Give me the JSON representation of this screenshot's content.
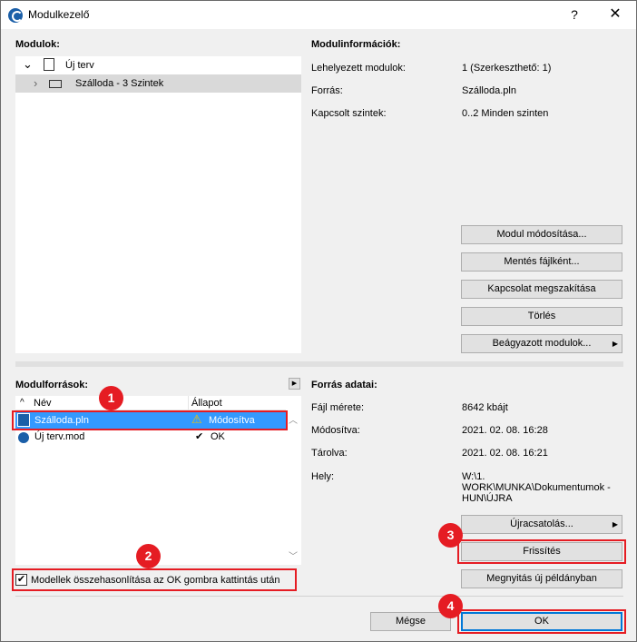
{
  "window": {
    "title": "Modulkezelő",
    "help": "?",
    "close": "✕"
  },
  "modules": {
    "heading": "Modulok:",
    "tree": [
      {
        "label": "Új terv",
        "expander": "⌄"
      },
      {
        "label": "Szálloda - 3 Szintek",
        "expander": "›"
      }
    ]
  },
  "module_info": {
    "heading": "Modulinformációk:",
    "rows": [
      {
        "key": "Lehelyezett modulok:",
        "value": "1 (Szerkeszthető: 1)"
      },
      {
        "key": "Forrás:",
        "value": "Szálloda.pln"
      },
      {
        "key": "Kapcsolt szintek:",
        "value": "0..2 Minden szinten"
      }
    ],
    "buttons": {
      "edit": "Modul módosítása...",
      "save_as_file": "Mentés fájlként...",
      "break_link": "Kapcsolat megszakítása",
      "delete": "Törlés",
      "embedded": "Beágyazott modulok...",
      "embedded_arrow": "▶"
    }
  },
  "module_sources": {
    "heading": "Modulforrások:",
    "expand_arrow": "▶",
    "columns": {
      "name": "Név",
      "status": "Állapot"
    },
    "rows": [
      {
        "name": "Szálloda.pln",
        "status": "Módosítva",
        "status_icon": "⚠"
      },
      {
        "name": "Új terv.mod",
        "status": "OK",
        "status_icon": "✔"
      }
    ],
    "scroll_up": "︿",
    "scroll_down": "﹀"
  },
  "source_data": {
    "heading": "Forrás adatai:",
    "rows": [
      {
        "key": "Fájl mérete:",
        "value": "8642 kbájt"
      },
      {
        "key": "Módosítva:",
        "value": "2021. 02. 08. 16:28"
      },
      {
        "key": "Tárolva:",
        "value": "2021. 02. 08. 16:21"
      },
      {
        "key": "Hely:",
        "value": "W:\\1.\nWORK\\MUNKA\\Dokumentumok -\nHUN\\ÚJRA"
      }
    ],
    "buttons": {
      "relink": "Újracsatolás...",
      "relink_arrow": "▶",
      "refresh": "Frissítés",
      "open_new_instance": "Megnyitás új példányban"
    }
  },
  "compare_checkbox": {
    "label": "Modellek összehasonlítása az OK gombra kattintás után",
    "checked": "✔"
  },
  "footer": {
    "cancel": "Mégse",
    "ok": "OK"
  },
  "badges": [
    "1",
    "2",
    "3",
    "4"
  ],
  "colors": {
    "highlight": "#e51c23",
    "selection": "#3399ff",
    "ok_border": "#0078d7"
  }
}
